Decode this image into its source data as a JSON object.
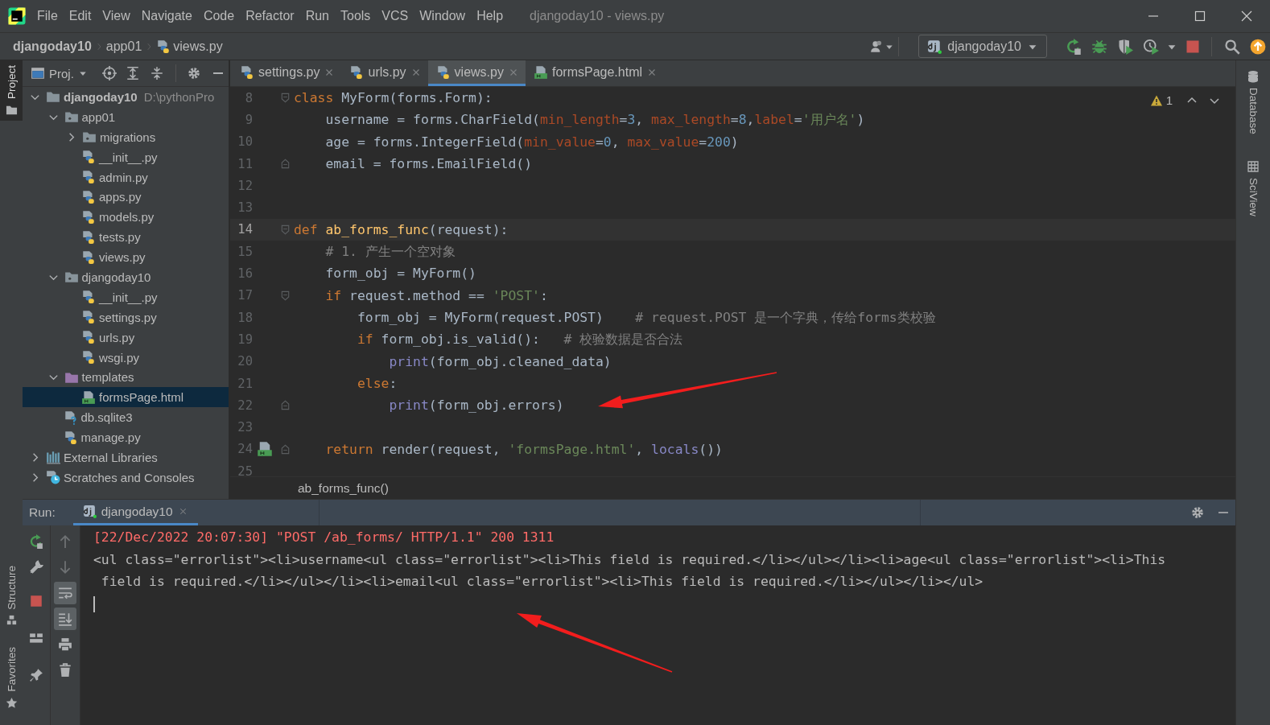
{
  "window": {
    "title": "djangoday10 - views.py"
  },
  "menu": [
    "File",
    "Edit",
    "View",
    "Navigate",
    "Code",
    "Refactor",
    "Run",
    "Tools",
    "VCS",
    "Window",
    "Help"
  ],
  "breadcrumbs": [
    {
      "label": "djangoday10",
      "kind": "project"
    },
    {
      "label": "app01",
      "kind": "folder"
    },
    {
      "label": "views.py",
      "kind": "py"
    }
  ],
  "run_config": {
    "label": "djangoday10"
  },
  "left_stripe": {
    "top": [
      {
        "label": "Project",
        "kind": "folder",
        "selected": true
      }
    ],
    "bottom": [
      {
        "label": "Structure",
        "kind": "structure",
        "selected": false
      },
      {
        "label": "Favorites",
        "kind": "star",
        "selected": false
      }
    ]
  },
  "right_stripe": [
    {
      "label": "Database",
      "kind": "database"
    },
    {
      "label": "SciView",
      "kind": "grid"
    }
  ],
  "project_panel": {
    "title": "Proj.",
    "tree": [
      {
        "name": "djangoday10",
        "kind": "project",
        "path": "D:\\pythonPro",
        "expanded": true,
        "selected": false,
        "children": [
          {
            "name": "app01",
            "kind": "package",
            "expanded": true,
            "selected": false,
            "children": [
              {
                "name": "migrations",
                "kind": "package",
                "expanded": false,
                "selected": false
              },
              {
                "name": "__init__.py",
                "kind": "py",
                "selected": false
              },
              {
                "name": "admin.py",
                "kind": "py",
                "selected": false
              },
              {
                "name": "apps.py",
                "kind": "py",
                "selected": false
              },
              {
                "name": "models.py",
                "kind": "py",
                "selected": false
              },
              {
                "name": "tests.py",
                "kind": "py",
                "selected": false
              },
              {
                "name": "views.py",
                "kind": "py",
                "selected": false
              }
            ]
          },
          {
            "name": "djangoday10",
            "kind": "package",
            "expanded": true,
            "selected": false,
            "children": [
              {
                "name": "__init__.py",
                "kind": "py",
                "selected": false
              },
              {
                "name": "settings.py",
                "kind": "py",
                "selected": false
              },
              {
                "name": "urls.py",
                "kind": "py",
                "selected": false
              },
              {
                "name": "wsgi.py",
                "kind": "py",
                "selected": false
              }
            ]
          },
          {
            "name": "templates",
            "kind": "templates",
            "expanded": true,
            "selected": false,
            "children": [
              {
                "name": "formsPage.html",
                "kind": "html",
                "selected": true
              }
            ]
          },
          {
            "name": "db.sqlite3",
            "kind": "unknown",
            "selected": false
          },
          {
            "name": "manage.py",
            "kind": "py",
            "selected": false
          }
        ]
      },
      {
        "name": "External Libraries",
        "kind": "libraries",
        "expanded": false,
        "selected": false
      },
      {
        "name": "Scratches and Consoles",
        "kind": "scratches",
        "expanded": false,
        "selected": false
      }
    ]
  },
  "editor": {
    "tabs": [
      {
        "label": "settings.py",
        "kind": "py",
        "selected": false
      },
      {
        "label": "urls.py",
        "kind": "py",
        "selected": false
      },
      {
        "label": "views.py",
        "kind": "py",
        "selected": true
      },
      {
        "label": "formsPage.html",
        "kind": "html",
        "selected": false
      }
    ],
    "inspection": {
      "count": "1"
    },
    "lines": [
      {
        "number": "8",
        "current": false,
        "fold_start": true,
        "tokens": [
          {
            "kind": "kw",
            "text": "class"
          },
          {
            "kind": "plain",
            "text": " MyForm(forms.Form):"
          }
        ]
      },
      {
        "number": "9",
        "current": false,
        "tokens": [
          {
            "kind": "plain",
            "text": "    username = forms.CharField("
          },
          {
            "kind": "param",
            "text": "min_length"
          },
          {
            "kind": "plain",
            "text": "="
          },
          {
            "kind": "num",
            "text": "3"
          },
          {
            "kind": "plain",
            "text": ", "
          },
          {
            "kind": "param",
            "text": "max_length"
          },
          {
            "kind": "plain",
            "text": "="
          },
          {
            "kind": "num",
            "text": "8"
          },
          {
            "kind": "plain",
            "text": ","
          },
          {
            "kind": "param",
            "text": "label"
          },
          {
            "kind": "plain",
            "text": "="
          },
          {
            "kind": "str",
            "text": "'用户名'"
          },
          {
            "kind": "plain",
            "text": ")"
          }
        ]
      },
      {
        "number": "10",
        "current": false,
        "tokens": [
          {
            "kind": "plain",
            "text": "    age = forms.IntegerField("
          },
          {
            "kind": "param",
            "text": "min_value"
          },
          {
            "kind": "plain",
            "text": "="
          },
          {
            "kind": "num",
            "text": "0"
          },
          {
            "kind": "plain",
            "text": ", "
          },
          {
            "kind": "param",
            "text": "max_value"
          },
          {
            "kind": "plain",
            "text": "="
          },
          {
            "kind": "num",
            "text": "200"
          },
          {
            "kind": "plain",
            "text": ")"
          }
        ]
      },
      {
        "number": "11",
        "current": false,
        "fold_end": true,
        "tokens": [
          {
            "kind": "plain",
            "text": "    email = forms.EmailField()"
          }
        ]
      },
      {
        "number": "12",
        "current": false
      },
      {
        "number": "13",
        "current": false
      },
      {
        "number": "14",
        "current": true,
        "fold_start": true,
        "tokens": [
          {
            "kind": "kw",
            "text": "def"
          },
          {
            "kind": "fn",
            "text": " ab_forms_func"
          },
          {
            "kind": "plain",
            "text": "(request):"
          }
        ]
      },
      {
        "number": "15",
        "current": false,
        "tokens": [
          {
            "kind": "comment",
            "text": "    # 1. 产生一个空对象"
          }
        ]
      },
      {
        "number": "16",
        "current": false,
        "tokens": [
          {
            "kind": "plain",
            "text": "    form_obj = MyForm()"
          }
        ]
      },
      {
        "number": "17",
        "current": false,
        "fold_start": true,
        "tokens": [
          {
            "kind": "kw",
            "text": "    if"
          },
          {
            "kind": "plain",
            "text": " request.method == "
          },
          {
            "kind": "str",
            "text": "'POST'"
          },
          {
            "kind": "plain",
            "text": ":"
          }
        ]
      },
      {
        "number": "18",
        "current": false,
        "tokens": [
          {
            "kind": "plain",
            "text": "        form_obj = MyForm(request.POST)    "
          },
          {
            "kind": "comment",
            "text": "# request.POST 是一个字典，传给forms类校验"
          }
        ]
      },
      {
        "number": "19",
        "current": false,
        "tokens": [
          {
            "kind": "kw",
            "text": "        if"
          },
          {
            "kind": "plain",
            "text": " form_obj.is_valid():   "
          },
          {
            "kind": "comment",
            "text": "# 校验数据是否合法"
          }
        ]
      },
      {
        "number": "20",
        "current": false,
        "tokens": [
          {
            "kind": "builtin",
            "text": "            print"
          },
          {
            "kind": "plain",
            "text": "(form_obj.cleaned_data)"
          }
        ]
      },
      {
        "number": "21",
        "current": false,
        "tokens": [
          {
            "kind": "kw",
            "text": "        else"
          },
          {
            "kind": "plain",
            "text": ":"
          }
        ]
      },
      {
        "number": "22",
        "current": false,
        "fold_end": true,
        "tokens": [
          {
            "kind": "builtin",
            "text": "            print"
          },
          {
            "kind": "plain",
            "text": "(form_obj.errors)"
          }
        ]
      },
      {
        "number": "23",
        "current": false
      },
      {
        "number": "24",
        "current": false,
        "fold_end": true,
        "template_link": true,
        "tokens": [
          {
            "kind": "kw",
            "text": "    return"
          },
          {
            "kind": "plain",
            "text": " render(request, "
          },
          {
            "kind": "str",
            "text": "'formsPage.html'"
          },
          {
            "kind": "plain",
            "text": ", "
          },
          {
            "kind": "builtin",
            "text": "locals"
          },
          {
            "kind": "plain",
            "text": "())"
          }
        ]
      },
      {
        "number": "25",
        "current": false
      }
    ],
    "breadcrumb": "ab_forms_func()"
  },
  "run": {
    "label": "Run:",
    "tabs": [
      {
        "label": "djangoday10",
        "selected": true
      }
    ],
    "console": [
      {
        "kind": "request",
        "text": "[22/Dec/2022 20:07:30] \"POST /ab_forms/ HTTP/1.1\" 200 1311"
      },
      {
        "kind": "output",
        "text": "<ul class=\"errorlist\"><li>username<ul class=\"errorlist\"><li>This field is required.</li></ul></li><li>age<ul class=\"errorlist\"><li>This"
      },
      {
        "kind": "output",
        "text": " field is required.</li></ul></li><li>email<ul class=\"errorlist\"><li>This field is required.</li></ul></li></ul>"
      }
    ]
  }
}
